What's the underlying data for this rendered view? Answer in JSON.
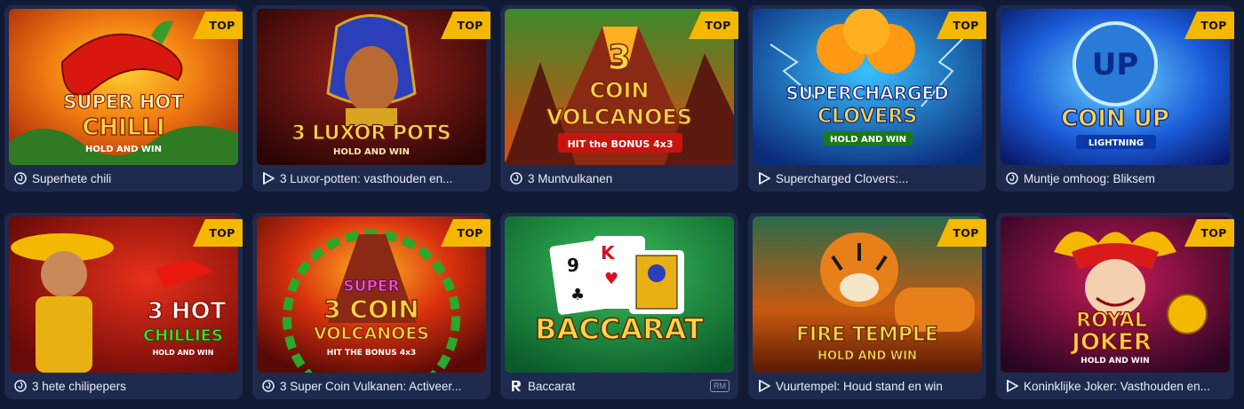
{
  "games": [
    {
      "title": "Superhete chili",
      "badge": "TOP",
      "provider_icon": "spiral-provider-icon",
      "logo": [
        "SUPER HOT",
        "CHILLI"
      ],
      "sub": "HOLD AND WIN"
    },
    {
      "title": "3 Luxor-potten: vasthouden en...",
      "badge": "TOP",
      "provider_icon": "play-provider-icon",
      "logo": [
        "3 LUXOR POTS"
      ],
      "sub": "HOLD AND WIN"
    },
    {
      "title": "3 Muntvulkanen",
      "badge": "TOP",
      "provider_icon": "spiral-provider-icon",
      "logo": [
        "3",
        "COIN",
        "VOLCANOES"
      ],
      "sub": "HIT the BONUS 4x3"
    },
    {
      "title": "Supercharged Clovers:...",
      "badge": "TOP",
      "provider_icon": "play-provider-icon",
      "logo": [
        "SUPERCHARGED",
        "CLOVERS"
      ],
      "sub": "HOLD AND WIN"
    },
    {
      "title": "Muntje omhoog: Bliksem",
      "badge": "TOP",
      "provider_icon": "spiral-provider-icon",
      "logo": [
        "UP",
        "COIN UP"
      ],
      "sub": "LIGHTNING"
    },
    {
      "title": "3 hete chilipepers",
      "badge": "TOP",
      "provider_icon": "spiral-provider-icon",
      "logo": [
        "3 HOT",
        "CHILLIES"
      ],
      "sub": "HOLD AND WIN"
    },
    {
      "title": "3 Super Coin Vulkanen: Activeer...",
      "badge": "TOP",
      "provider_icon": "spiral-provider-icon",
      "logo": [
        "SUPER",
        "3 COIN",
        "VOLCANOES"
      ],
      "sub": "HIT THE BONUS 4x3"
    },
    {
      "title": "Baccarat",
      "badge": "",
      "provider_icon": "r-provider-icon",
      "tag": "RM",
      "logo": [
        "BACCARAT"
      ],
      "sub": ""
    },
    {
      "title": "Vuurtempel: Houd stand en win",
      "badge": "TOP",
      "provider_icon": "play-provider-icon",
      "logo": [
        "FIRE TEMPLE"
      ],
      "sub": "HOLD AND WIN"
    },
    {
      "title": "Koninklijke Joker: Vasthouden en...",
      "badge": "TOP",
      "provider_icon": "play-provider-icon",
      "logo": [
        "ROYAL",
        "JOKER"
      ],
      "sub": "HOLD AND WIN"
    }
  ],
  "colors": {
    "background": "#101a35",
    "card": "#1e2a4d",
    "badge": "#f5b800",
    "title_text": "#e9edf7"
  }
}
